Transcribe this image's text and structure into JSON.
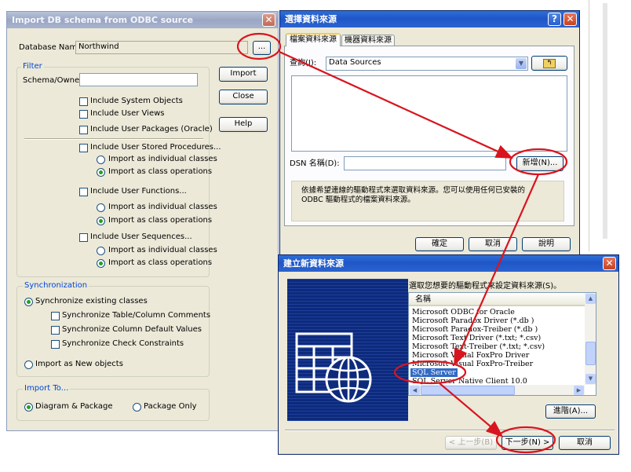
{
  "import_dialog": {
    "title": "Import DB schema from ODBC source",
    "db_name_label": "Database Name:",
    "db_name_value": "Northwind",
    "browse_button": "...",
    "filter_label": "Filter",
    "schema_owner_label": "Schema/Owner:",
    "schema_owner_value": "",
    "import_button": "Import",
    "close_button": "Close",
    "help_button": "Help",
    "include_system_objects": "Include System Objects",
    "include_user_views": "Include User Views",
    "include_user_packages": "Include User Packages (Oracle)",
    "include_stored_procedures": "Include User Stored Procedures...",
    "sp_individual": "Import as individual classes",
    "sp_operations": "Import as class operations",
    "include_functions": "Include User Functions...",
    "fn_individual": "Import as individual classes",
    "fn_operations": "Import as class operations",
    "include_sequences": "Include User Sequences...",
    "seq_individual": "Import as individual classes",
    "seq_operations": "Import as class operations",
    "sync_label": "Synchronization",
    "sync_existing": "Synchronize existing classes",
    "sync_comments": "Synchronize Table/Column Comments",
    "sync_defaults": "Synchronize Column Default Values",
    "sync_constraints": "Synchronize Check Constraints",
    "import_new": "Import as New objects",
    "import_to_label": "Import To...",
    "diagram_package": "Diagram & Package",
    "package_only": "Package Only"
  },
  "dsn_dialog": {
    "title": "選擇資料來源",
    "tab_file": "檔案資料來源",
    "tab_machine": "機器資料來源",
    "lookin_label": "查詢(I):",
    "lookin_value": "Data Sources",
    "dsn_name_label": "DSN 名稱(D):",
    "dsn_name_value": "",
    "new_button": "新增(N)...",
    "description": "依據希望連線的驅動程式來選取資料來源。您可以使用任何已安裝的 ODBC 驅動程式的檔案資料來源。",
    "ok_button": "確定",
    "cancel_button": "取消",
    "help_button": "說明"
  },
  "new_ds_dialog": {
    "title": "建立新資料來源",
    "instruction": "選取您想要的驅動程式來設定資料來源(S)。",
    "column_header": "名稱",
    "drivers": [
      "Microsoft ODBC for Oracle",
      "Microsoft Paradox Driver (*.db )",
      "Microsoft Paradox-Treiber (*.db )",
      "Microsoft Text Driver (*.txt; *.csv)",
      "Microsoft Text-Treiber (*.txt; *.csv)",
      "Microsoft Visual FoxPro Driver",
      "Microsoft Visual FoxPro-Treiber",
      "SQL Server",
      "SQL Server Native Client 10.0"
    ],
    "selected_driver": "SQL Server",
    "advanced_button": "進階(A)...",
    "back_button": "< 上一步(B)",
    "next_button": "下一步(N) >",
    "cancel_button": "取消"
  },
  "colors": {
    "titlebar_active": "#1f56c8",
    "titlebar_inactive": "#9aa6c4",
    "dialog_bg": "#ece9d8",
    "annotation_red": "#d8151f",
    "selection_blue": "#316ac5"
  }
}
